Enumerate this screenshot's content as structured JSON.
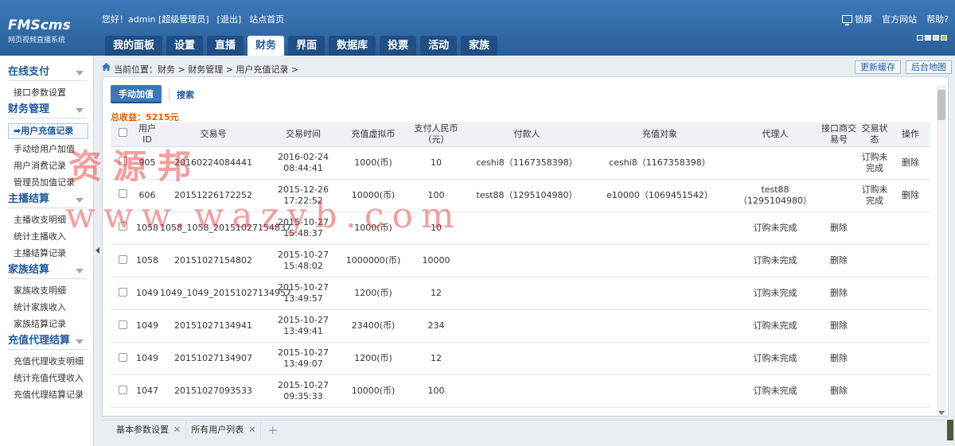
{
  "app": {
    "logo": "FMScms",
    "logo_sub": "网页视频直播系统"
  },
  "userbar": {
    "greeting": "您好！admin [超级管理员]",
    "logout": "[退出]",
    "home": "站点首页"
  },
  "rightbar": {
    "lock": "锁屏",
    "official": "官方网站",
    "help": "帮助?"
  },
  "nav": [
    {
      "label": "我的面板"
    },
    {
      "label": "设置"
    },
    {
      "label": "直播"
    },
    {
      "label": "财务"
    },
    {
      "label": "界面"
    },
    {
      "label": "数据库"
    },
    {
      "label": "投票"
    },
    {
      "label": "活动"
    },
    {
      "label": "家族"
    }
  ],
  "sidebar": {
    "groups": [
      {
        "title": "在线支付",
        "items": [
          "接口参数设置"
        ]
      },
      {
        "title": "财务管理",
        "items": [
          "➡用户充值记录",
          "手动给用户加值",
          "用户消费记录",
          "管理员加值记录"
        ]
      },
      {
        "title": "主播结算",
        "items": [
          "主播收支明细",
          "统计主播收入",
          "主播结算记录"
        ]
      },
      {
        "title": "家族结算",
        "items": [
          "家族收支明细",
          "统计家族收入",
          "家族结算记录"
        ]
      },
      {
        "title": "充值代理结算",
        "items": [
          "充值代理收支明细",
          "统计充值代理收入",
          "充值代理结算记录"
        ]
      }
    ]
  },
  "breadcrumb": "当前位置：财务 > 财务管理 > 用户充值记录 >",
  "topbuttons": {
    "refresh": "更新缓存",
    "sitemap": "后台地图"
  },
  "toolbar": {
    "add": "手动加值",
    "search": "搜索"
  },
  "total": "总收益：5215元",
  "table": {
    "headers": [
      "",
      "用户ID",
      "交易号",
      "交易时间",
      "充值虚拟币",
      "支付人民币（元）",
      "付款人",
      "充值对象",
      "代理人",
      "接口商交易号",
      "交易状态",
      "操作"
    ],
    "rows_a": [
      {
        "uid": "905",
        "trade": "20160224084441",
        "date": "2016-02-24",
        "time": "08:44:41",
        "coin": "1000(币)",
        "rmb": "10",
        "payer": "ceshi8（1167358398）",
        "target": "ceshi8（1167358398）",
        "agent": "",
        "status": "订购未完成",
        "op": "删除"
      },
      {
        "uid": "606",
        "trade": "20151226172252",
        "date": "2015-12-26",
        "time": "17:22:52",
        "coin": "10000(币)",
        "rmb": "100",
        "payer": "test88（1295104980）",
        "target": "e10000（1069451542）",
        "agent": "test88（1295104980）",
        "status": "订购未完成",
        "op": "删除"
      }
    ],
    "rows_b": [
      {
        "uid": "1058",
        "trade": "1058_1058_20151027154837",
        "date": "2015-10-27",
        "time": "15:48:37",
        "coin": "1000(币)",
        "rmb": "10",
        "status": "订购未完成",
        "op": "删除"
      },
      {
        "uid": "1058",
        "trade": "20151027154802",
        "date": "2015-10-27",
        "time": "15:48:02",
        "coin": "1000000(币)",
        "rmb": "10000",
        "status": "订购未完成",
        "op": "删除"
      },
      {
        "uid": "1049",
        "trade": "1049_1049_20151027134957",
        "date": "2015-10-27",
        "time": "13:49:57",
        "coin": "1200(币)",
        "rmb": "12",
        "status": "订购未完成",
        "op": "删除"
      },
      {
        "uid": "1049",
        "trade": "20151027134941",
        "date": "2015-10-27",
        "time": "13:49:41",
        "coin": "23400(币)",
        "rmb": "234",
        "status": "订购未完成",
        "op": "删除"
      },
      {
        "uid": "1049",
        "trade": "20151027134907",
        "date": "2015-10-27",
        "time": "13:49:07",
        "coin": "1200(币)",
        "rmb": "12",
        "status": "订购未完成",
        "op": "删除"
      },
      {
        "uid": "1047",
        "trade": "20151027093533",
        "date": "2015-10-27",
        "time": "09:35:33",
        "coin": "10000(币)",
        "rmb": "100",
        "status": "订购未完成",
        "op": "删除"
      }
    ]
  },
  "bottomtabs": [
    {
      "label": "基本参数设置"
    },
    {
      "label": "所有用户列表"
    }
  ],
  "watermark": {
    "line1": "资源邦",
    "line2": "www.wazyb.com"
  }
}
